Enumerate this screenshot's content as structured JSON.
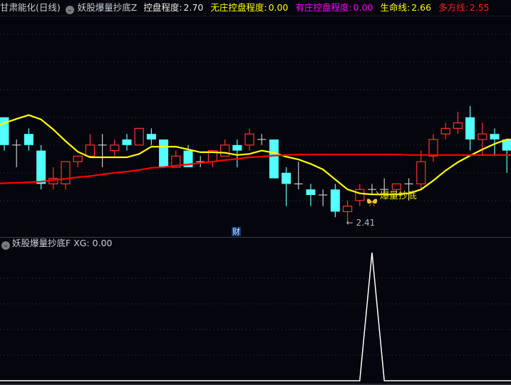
{
  "header": {
    "stock": "甘肃能化(日线)",
    "indicator": "妖股爆量抄底Z",
    "items": [
      {
        "label": "控盘程度:",
        "value": "2.70",
        "color": "#e8e8e8"
      },
      {
        "label": "无庄控盘程度:",
        "value": "0.00",
        "color": "#ffff00"
      },
      {
        "label": "有庄控盘程度:",
        "value": "0.00",
        "color": "#ff00ff"
      },
      {
        "label": "生命线:",
        "value": "2.66",
        "color": "#ffff00"
      },
      {
        "label": "多方线:",
        "value": "2.55",
        "color": "#ff2020"
      }
    ]
  },
  "sub_header": {
    "indicator": "妖股爆量抄底F",
    "label": "XG:",
    "value": "0.00"
  },
  "finance_badge": "财",
  "annotations": {
    "low_label": "2.41",
    "signal_text": "爆量抄底",
    "signal_icon": "butterfly-icon"
  },
  "colors": {
    "up": "#ff3232",
    "down": "#54ffff",
    "doji": "#c8c8c8",
    "life_line": "#ffff00",
    "bull_line": "#ff0000",
    "xg": "#ffffff",
    "background": "#05050d"
  },
  "chart_data": [
    {
      "type": "candlestick",
      "ylim": [
        2.38,
        2.77
      ],
      "grid": true,
      "ohlc": [
        [
          2.6,
          2.6,
          2.54,
          2.55
        ],
        [
          2.55,
          2.56,
          2.51,
          2.55
        ],
        [
          2.57,
          2.58,
          2.54,
          2.55
        ],
        [
          2.54,
          2.55,
          2.47,
          2.48
        ],
        [
          2.48,
          2.51,
          2.47,
          2.49
        ],
        [
          2.48,
          2.52,
          2.47,
          2.52
        ],
        [
          2.52,
          2.53,
          2.51,
          2.53
        ],
        [
          2.53,
          2.57,
          2.53,
          2.55
        ],
        [
          2.55,
          2.57,
          2.51,
          2.55
        ],
        [
          2.54,
          2.56,
          2.53,
          2.55
        ],
        [
          2.56,
          2.57,
          2.54,
          2.55
        ],
        [
          2.55,
          2.58,
          2.55,
          2.58
        ],
        [
          2.57,
          2.58,
          2.55,
          2.56
        ],
        [
          2.56,
          2.56,
          2.51,
          2.51
        ],
        [
          2.51,
          2.54,
          2.51,
          2.53
        ],
        [
          2.54,
          2.55,
          2.51,
          2.51
        ],
        [
          2.52,
          2.53,
          2.51,
          2.52
        ],
        [
          2.52,
          2.54,
          2.51,
          2.54
        ],
        [
          2.53,
          2.56,
          2.53,
          2.55
        ],
        [
          2.55,
          2.56,
          2.51,
          2.54
        ],
        [
          2.55,
          2.58,
          2.54,
          2.57
        ],
        [
          2.56,
          2.57,
          2.55,
          2.56
        ],
        [
          2.56,
          2.56,
          2.49,
          2.49
        ],
        [
          2.5,
          2.51,
          2.44,
          2.48
        ],
        [
          2.48,
          2.52,
          2.47,
          2.48
        ],
        [
          2.47,
          2.48,
          2.44,
          2.46
        ],
        [
          2.46,
          2.47,
          2.44,
          2.46
        ],
        [
          2.47,
          2.48,
          2.42,
          2.43
        ],
        [
          2.43,
          2.45,
          2.41,
          2.44
        ],
        [
          2.45,
          2.48,
          2.44,
          2.47
        ],
        [
          2.47,
          2.48,
          2.46,
          2.47
        ],
        [
          2.47,
          2.49,
          2.46,
          2.47
        ],
        [
          2.47,
          2.48,
          2.46,
          2.48
        ],
        [
          2.48,
          2.49,
          2.45,
          2.48
        ],
        [
          2.48,
          2.54,
          2.47,
          2.52
        ],
        [
          2.53,
          2.57,
          2.52,
          2.56
        ],
        [
          2.57,
          2.59,
          2.56,
          2.58
        ],
        [
          2.58,
          2.61,
          2.57,
          2.59
        ],
        [
          2.6,
          2.62,
          2.54,
          2.56
        ],
        [
          2.56,
          2.59,
          2.53,
          2.57
        ],
        [
          2.57,
          2.58,
          2.53,
          2.56
        ],
        [
          2.56,
          2.56,
          2.5,
          2.54
        ]
      ],
      "series": [
        {
          "name": "生命线",
          "values": [
            2.587,
            2.597,
            2.604,
            2.596,
            2.578,
            2.557,
            2.538,
            2.528,
            2.528,
            2.528,
            2.528,
            2.534,
            2.547,
            2.547,
            2.547,
            2.542,
            2.537,
            2.537,
            2.536,
            2.532,
            2.534,
            2.54,
            2.536,
            2.529,
            2.524,
            2.516,
            2.506,
            2.488,
            2.47,
            2.463,
            2.461,
            2.461,
            2.461,
            2.463,
            2.47,
            2.486,
            2.504,
            2.519,
            2.531,
            2.542,
            2.552,
            2.56
          ]
        },
        {
          "name": "多方线",
          "values": [
            2.481,
            2.482,
            2.483,
            2.484,
            2.487,
            2.489,
            2.492,
            2.494,
            2.497,
            2.5,
            2.502,
            2.505,
            2.509,
            2.51,
            2.513,
            2.515,
            2.518,
            2.52,
            2.523,
            2.525,
            2.528,
            2.529,
            2.531,
            2.532,
            2.533,
            2.533,
            2.533,
            2.533,
            2.533,
            2.533,
            2.533,
            2.533,
            2.533,
            2.532,
            2.532,
            2.532,
            2.532,
            2.532,
            2.532,
            2.532,
            2.532,
            2.532
          ]
        }
      ],
      "low_marker": {
        "index": 28,
        "value": 2.41
      },
      "signal_index": 30
    },
    {
      "type": "line",
      "name": "XG",
      "ylim": [
        0,
        1
      ],
      "values": [
        0,
        0,
        0,
        0,
        0,
        0,
        0,
        0,
        0,
        0,
        0,
        0,
        0,
        0,
        0,
        0,
        0,
        0,
        0,
        0,
        0,
        0,
        0,
        0,
        0,
        0,
        0,
        0,
        0,
        0,
        1,
        0,
        0,
        0,
        0,
        0,
        0,
        0,
        0,
        0,
        0,
        0
      ]
    }
  ]
}
